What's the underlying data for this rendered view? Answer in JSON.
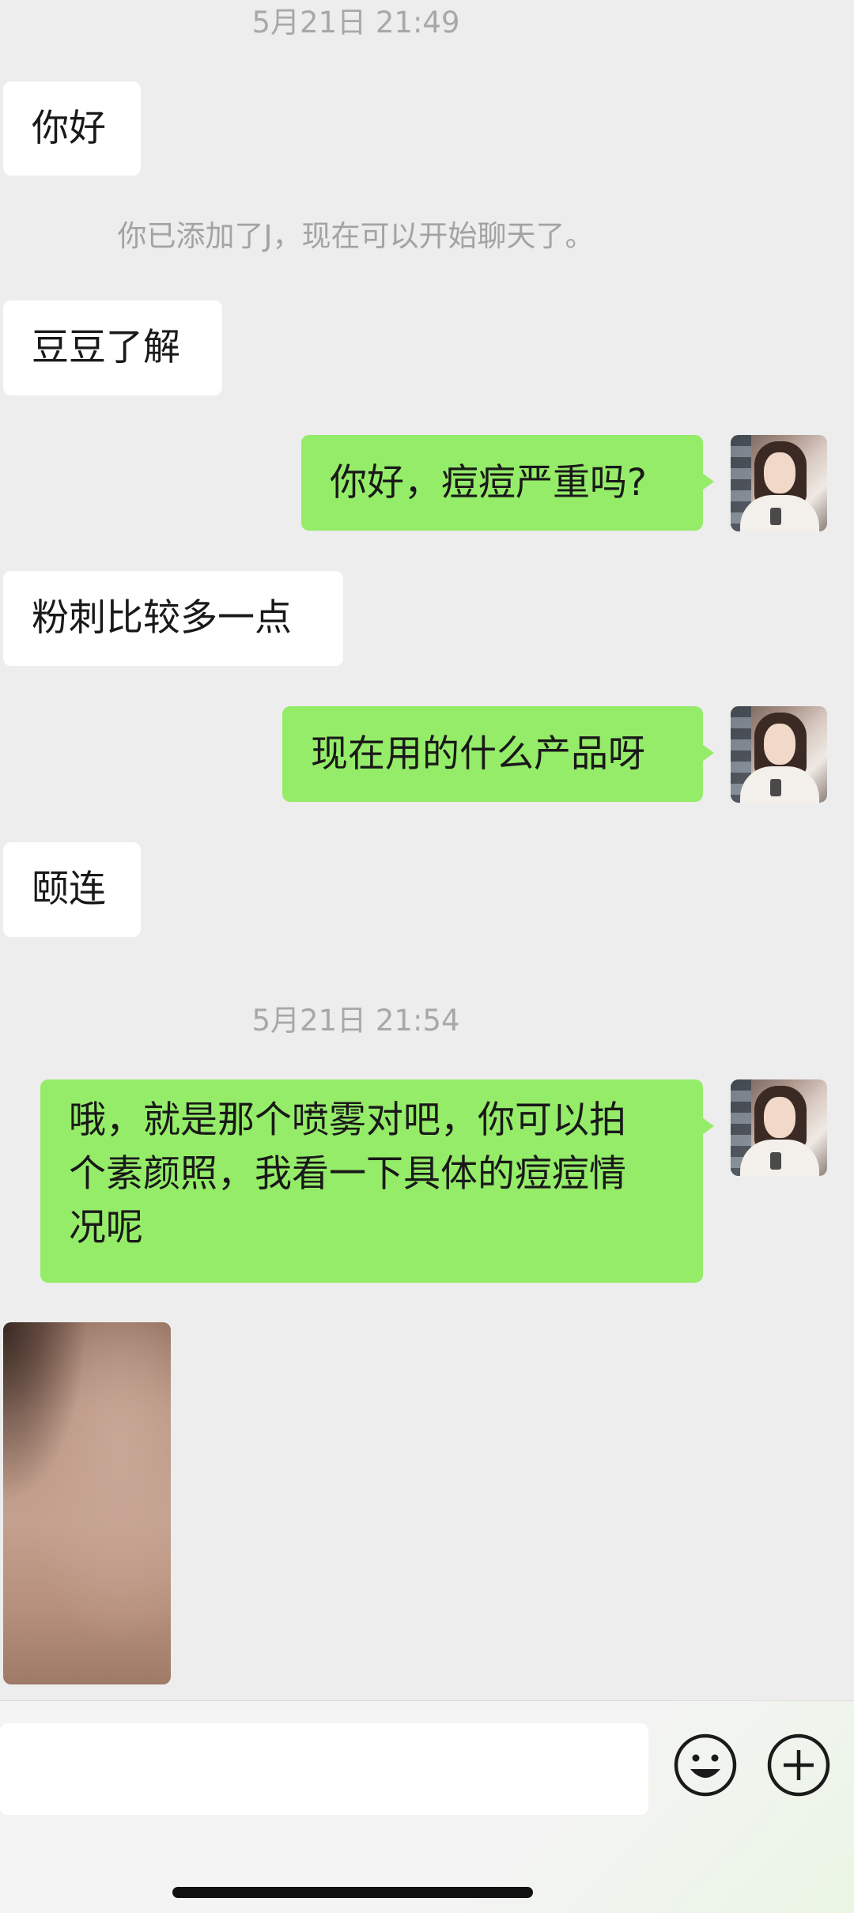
{
  "chat": {
    "timestamp_1": "5月21日 21:49",
    "msg_1": "你好",
    "system_msg": "你已添加了J，现在可以开始聊天了。",
    "msg_2": "豆豆了解",
    "msg_3": "你好，痘痘严重吗?",
    "msg_4": "粉刺比较多一点",
    "msg_5": "现在用的什么产品呀",
    "msg_6": "颐连",
    "timestamp_2": "5月21日 21:54",
    "msg_7_line_1": "哦，就是那个喷雾对吧，你可以拍",
    "msg_7_line_2": "个素颜照，我看一下具体的痘痘情",
    "msg_7_line_3": "况呢"
  },
  "input_bar": {
    "input_value": "",
    "emoji_icon": "smiley-face-icon",
    "more_icon": "plus-circle-icon"
  },
  "colors": {
    "background": "#ededed",
    "incoming_bubble": "#ffffff",
    "outgoing_bubble": "#95ec69",
    "timestamp_text": "#a8a8a8"
  }
}
